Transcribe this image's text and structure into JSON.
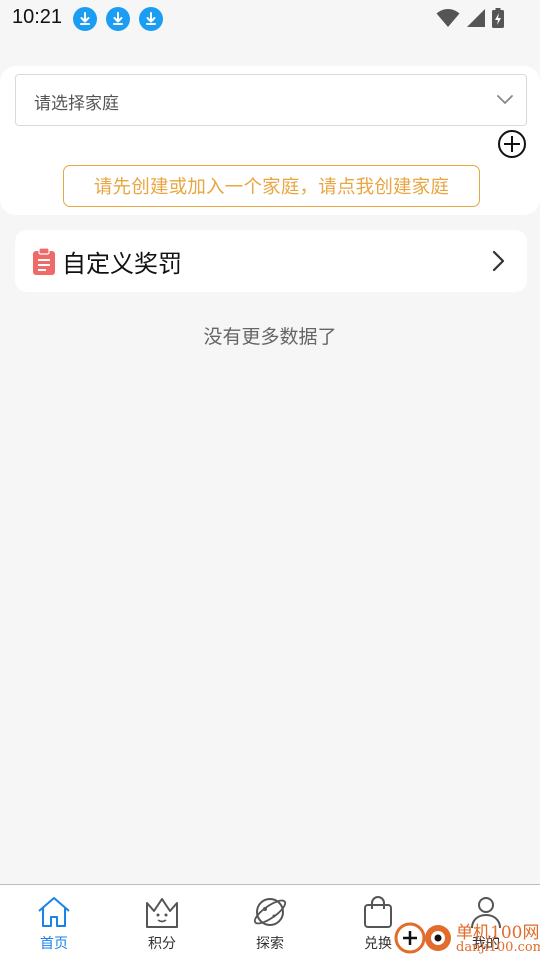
{
  "status_bar": {
    "time": "10:21",
    "left_icons": [
      "download-icon",
      "download-icon",
      "download-icon"
    ],
    "right_icons": [
      "wifi-icon",
      "signal-icon",
      "battery-charging-icon"
    ]
  },
  "family": {
    "select_placeholder": "请选择家庭",
    "create_hint": "请先创建或加入一个家庭，请点我创建家庭"
  },
  "reward": {
    "title": "自定义奖罚"
  },
  "list": {
    "end_text": "没有更多数据了"
  },
  "bottom_nav": {
    "items": [
      {
        "label": "首页",
        "icon": "home-icon",
        "active": true
      },
      {
        "label": "积分",
        "icon": "crown-icon",
        "active": false
      },
      {
        "label": "探索",
        "icon": "planet-icon",
        "active": false
      },
      {
        "label": "兑换",
        "icon": "shopping-bag-icon",
        "active": false
      },
      {
        "label": "我的",
        "icon": "user-icon",
        "active": false
      }
    ]
  },
  "watermark": {
    "name": "单机100网",
    "url": "danji100.com"
  },
  "colors": {
    "accent_blue": "#1a82e8",
    "hint_orange": "#e9a643",
    "reward_icon_red": "#f06a6a",
    "status_download_blue": "#1a9df2"
  }
}
